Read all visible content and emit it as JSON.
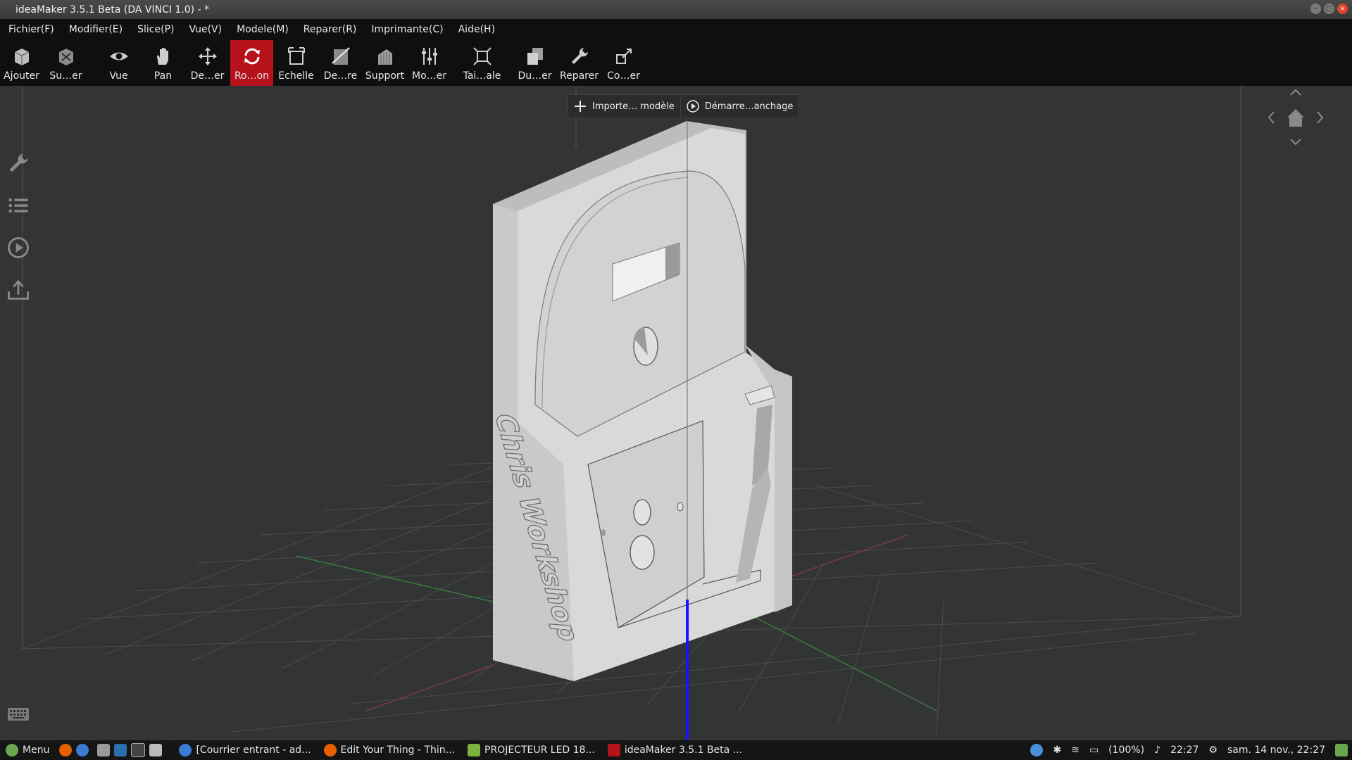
{
  "window": {
    "title": "ideaMaker 3.5.1 Beta (DA VINCI 1.0) - *"
  },
  "menu": [
    {
      "label": "Fichier(F)"
    },
    {
      "label": "Modifier(E)"
    },
    {
      "label": "Slice(P)"
    },
    {
      "label": "Vue(V)"
    },
    {
      "label": "Modele(M)"
    },
    {
      "label": "Reparer(R)"
    },
    {
      "label": "Imprimante(C)"
    },
    {
      "label": "Aide(H)"
    }
  ],
  "toolbar": [
    {
      "label": "Ajouter",
      "icon": "add-model-icon"
    },
    {
      "label": "Su…er",
      "icon": "remove-model-icon"
    },
    {
      "label": "Vue",
      "icon": "eye-icon"
    },
    {
      "label": "Pan",
      "icon": "hand-icon"
    },
    {
      "label": "De…er",
      "icon": "move-icon"
    },
    {
      "label": "Ro…on",
      "icon": "rotate-icon",
      "active": true
    },
    {
      "label": "Echelle",
      "icon": "scale-icon"
    },
    {
      "label": "De…re",
      "icon": "cut-icon"
    },
    {
      "label": "Support",
      "icon": "support-icon"
    },
    {
      "label": "Mo…er",
      "icon": "modifier-icon"
    },
    {
      "label": "Tai…ale",
      "icon": "layflat-icon"
    },
    {
      "label": "Du…er",
      "icon": "duplicate-icon"
    },
    {
      "label": "Reparer",
      "icon": "wrench-icon"
    },
    {
      "label": "Co…er",
      "icon": "connect-icon"
    }
  ],
  "actions": {
    "import_label": "Importe… modèle",
    "start_label": "Démarre…anchage"
  },
  "side_panel": [
    {
      "icon": "wrench-icon"
    },
    {
      "icon": "list-icon"
    },
    {
      "icon": "play-circle-icon"
    },
    {
      "icon": "upload-icon"
    }
  ],
  "model": {
    "engraving": "Chris Workshop"
  },
  "colors": {
    "accent": "#b5121b",
    "background": "#323436",
    "model": "#d9d9d9",
    "z_axis": "#1414ff"
  },
  "taskbar": {
    "menu_label": "Menu",
    "tasks": [
      {
        "label": "[Courrier entrant - ad...",
        "icon": "mail-icon"
      },
      {
        "label": "Edit Your Thing - Thin...",
        "icon": "firefox-icon"
      },
      {
        "label": "PROJECTEUR LED 18...",
        "icon": "folder-icon"
      },
      {
        "label": "ideaMaker 3.5.1 Beta ...",
        "icon": "ideamaker-icon"
      }
    ],
    "battery": "(100%)",
    "time": "22:27",
    "datetime": "sam. 14 nov., 22:27"
  }
}
